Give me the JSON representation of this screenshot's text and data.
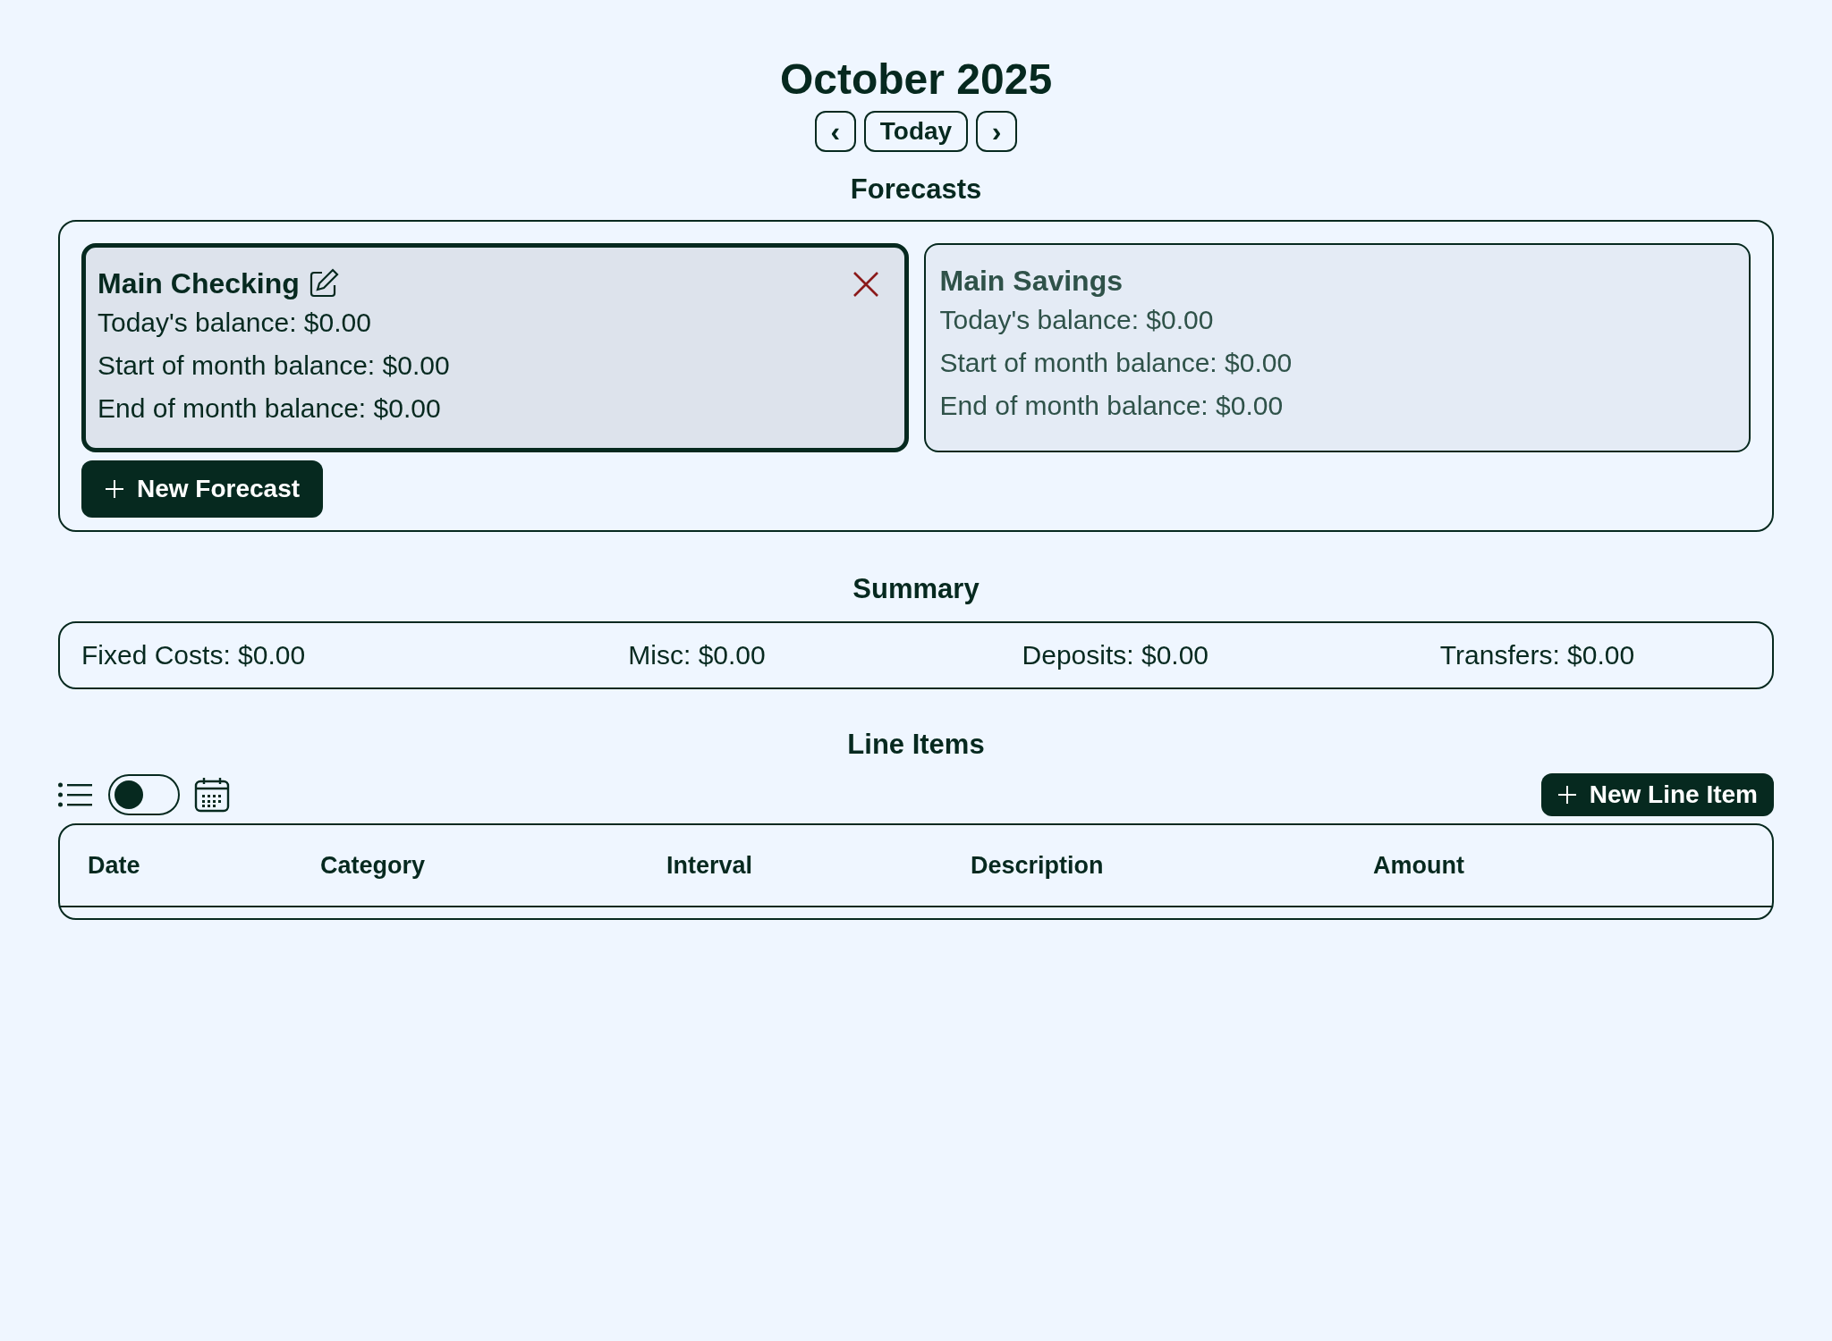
{
  "header": {
    "title": "October 2025",
    "nav": [
      {
        "kind": "prev",
        "label": "‹"
      },
      {
        "kind": "today",
        "label": "Today"
      },
      {
        "kind": "next",
        "label": "›"
      }
    ]
  },
  "forecasts": {
    "heading": "Forecasts",
    "items": [
      {
        "name": "Main Checking",
        "selected": true,
        "lines": [
          "Today's balance: $0.00",
          "Start of month balance: $0.00",
          "End of month balance: $0.00"
        ]
      },
      {
        "name": "Main Savings",
        "selected": false,
        "lines": [
          "Today's balance: $0.00",
          "Start of month balance: $0.00",
          "End of month balance: $0.00"
        ]
      }
    ],
    "new_button": "New Forecast"
  },
  "summary": {
    "heading": "Summary",
    "items": [
      "Fixed Costs: $0.00",
      "Misc: $0.00",
      "Deposits: $0.00",
      "Transfers: $0.00"
    ]
  },
  "line_items": {
    "heading": "Line Items",
    "calendar_view": false,
    "new_button": "New Line Item",
    "columns": [
      "Date",
      "Category",
      "Interval",
      "Description",
      "Amount"
    ]
  }
}
